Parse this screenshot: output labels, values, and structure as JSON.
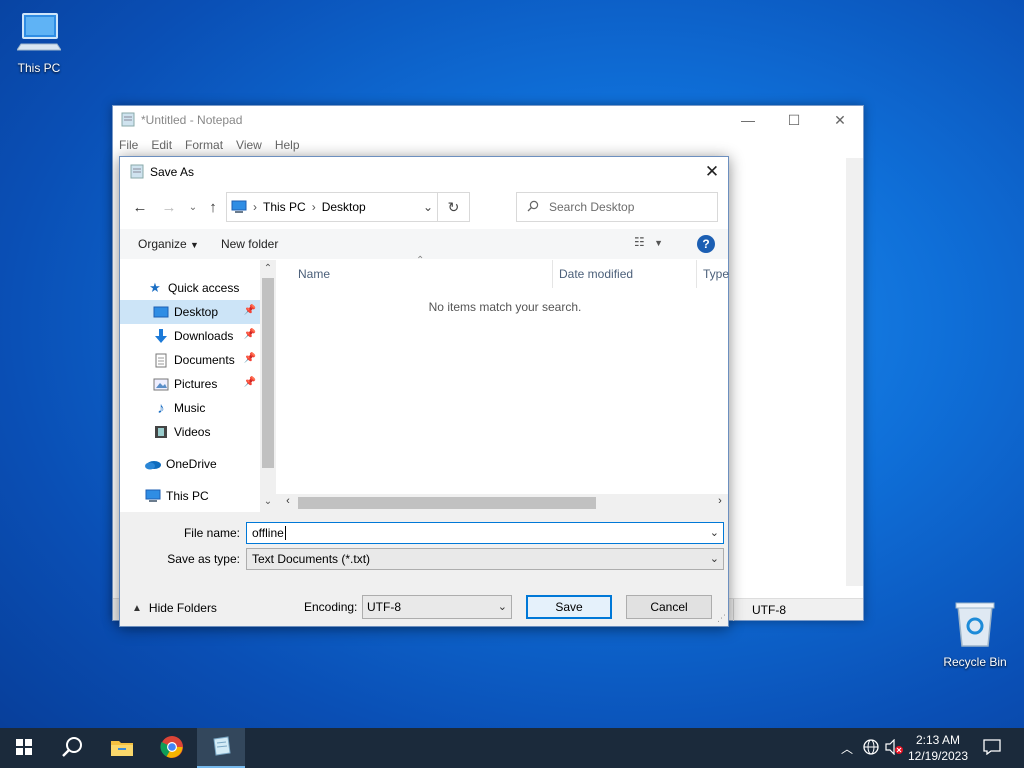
{
  "desktop": {
    "icons": [
      {
        "label": "This PC"
      },
      {
        "label": "Recycle Bin"
      }
    ]
  },
  "notepad": {
    "title": "*Untitled - Notepad",
    "menu": [
      "File",
      "Edit",
      "Format",
      "View",
      "Help"
    ],
    "status_encoding": "UTF-8"
  },
  "dialog": {
    "title": "Save As",
    "breadcrumb": [
      "This PC",
      "Desktop"
    ],
    "search_placeholder": "Search Desktop",
    "toolbar": {
      "organize": "Organize",
      "new_folder": "New folder"
    },
    "nav": {
      "quick_access": "Quick access",
      "items": [
        {
          "label": "Desktop",
          "pinned": true,
          "selected": true
        },
        {
          "label": "Downloads",
          "pinned": true
        },
        {
          "label": "Documents",
          "pinned": true
        },
        {
          "label": "Pictures",
          "pinned": true
        },
        {
          "label": "Music"
        },
        {
          "label": "Videos"
        }
      ],
      "onedrive": "OneDrive",
      "this_pc": "This PC"
    },
    "columns": [
      "Name",
      "Date modified",
      "Type"
    ],
    "empty_message": "No items match your search.",
    "file_name_label": "File name:",
    "file_name_value": "offline",
    "save_type_label": "Save as type:",
    "save_type_value": "Text Documents (*.txt)",
    "hide_folders": "Hide Folders",
    "encoding_label": "Encoding:",
    "encoding_value": "UTF-8",
    "save_button": "Save",
    "cancel_button": "Cancel"
  },
  "taskbar": {
    "time": "2:13 AM",
    "date": "12/19/2023"
  },
  "colors": {
    "accent": "#0078d7",
    "selection": "#cce4f7",
    "taskbar": "#1b2a3b"
  }
}
